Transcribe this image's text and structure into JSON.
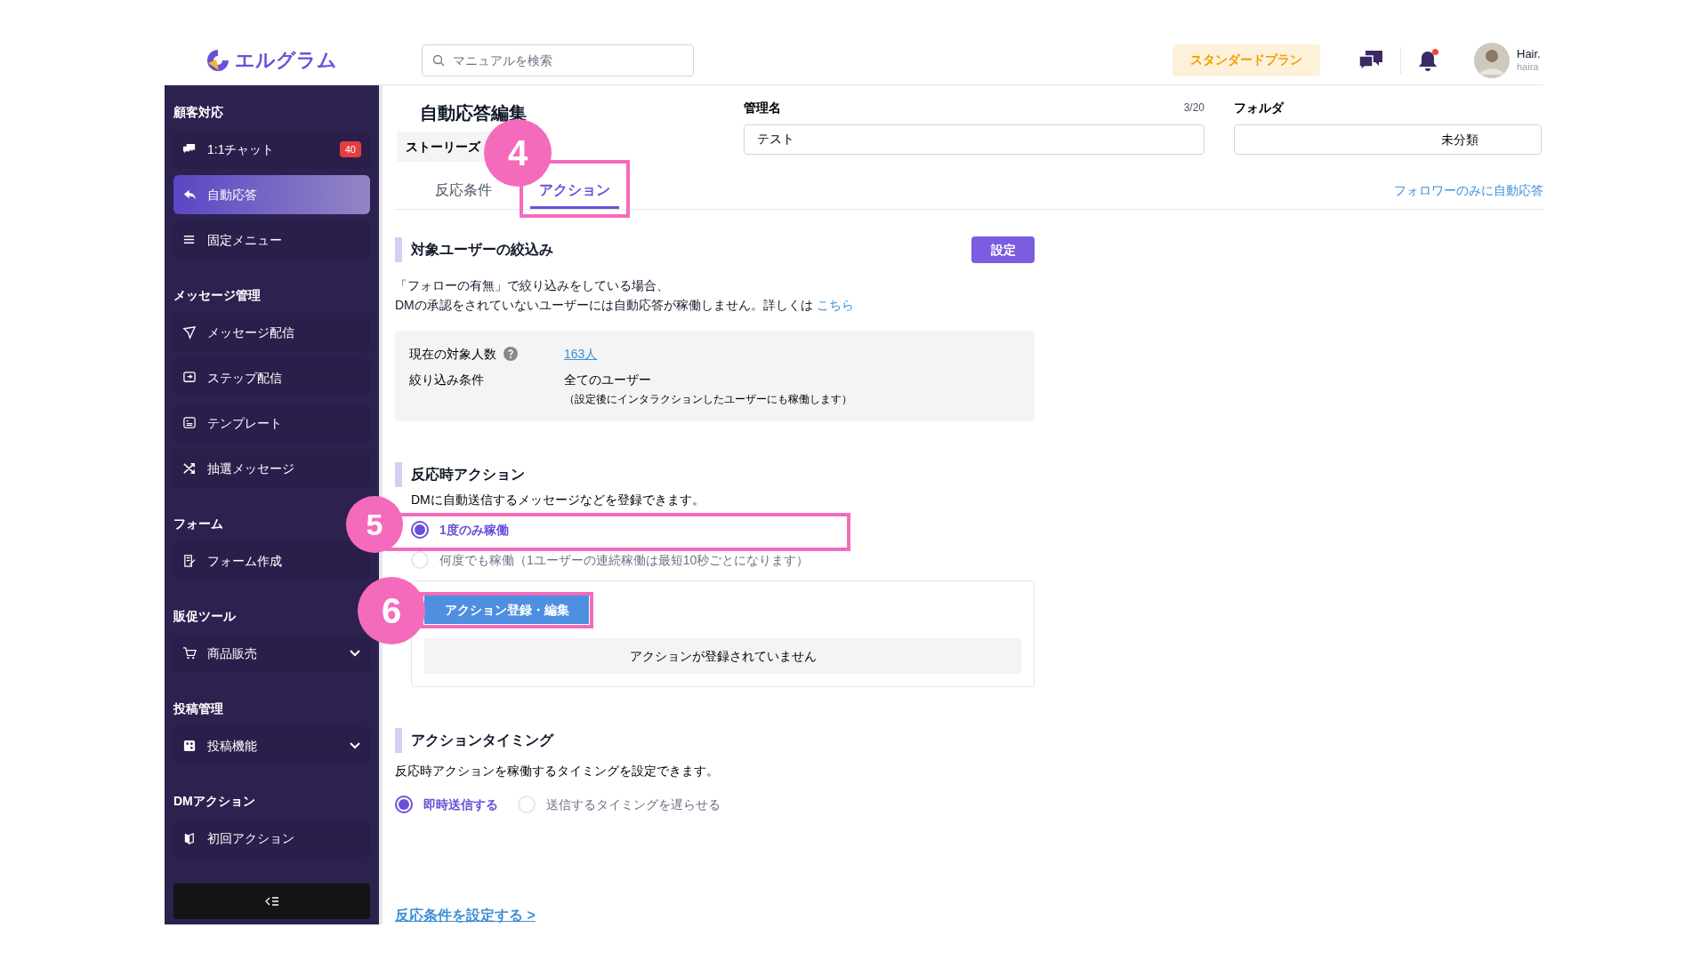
{
  "header": {
    "logo": "エルグラム",
    "search": {
      "placeholder": "マニュアルを検索"
    },
    "plan": "スタンダードプラン",
    "notification": true,
    "user": {
      "name": "Hair.",
      "id": "haira"
    }
  },
  "sidebar": {
    "sections": [
      {
        "title": "顧客対応",
        "items": [
          {
            "label": "1:1チャット",
            "badge": "40",
            "selected": false,
            "kind": "link"
          },
          {
            "label": "自動応答",
            "selected": true,
            "kind": "link"
          },
          {
            "label": "固定メニュー",
            "selected": false,
            "kind": "link"
          }
        ]
      },
      {
        "title": "メッセージ管理",
        "items": [
          {
            "label": "メッセージ配信",
            "selected": false,
            "kind": "link"
          },
          {
            "label": "ステップ配信",
            "selected": false,
            "kind": "link"
          },
          {
            "label": "テンプレート",
            "selected": false,
            "kind": "link"
          },
          {
            "label": "抽選メッセージ",
            "selected": false,
            "kind": "link"
          }
        ]
      },
      {
        "title": "フォーム",
        "items": [
          {
            "label": "フォーム作成",
            "selected": false,
            "kind": "link"
          }
        ]
      },
      {
        "title": "販促ツール",
        "items": [
          {
            "label": "商品販売",
            "selected": false,
            "kind": "dropdown"
          }
        ]
      },
      {
        "title": "投稿管理",
        "items": [
          {
            "label": "投稿機能",
            "selected": false,
            "kind": "dropdown"
          }
        ]
      },
      {
        "title": "DMアクション",
        "items": [
          {
            "label": "初回アクション",
            "selected": false,
            "kind": "link"
          }
        ]
      }
    ]
  },
  "editor": {
    "title": "自動応答編集",
    "chip": "ストーリーズ",
    "name_field": {
      "label": "管理名",
      "counter": "3/20",
      "value": "テスト"
    },
    "folder_field": {
      "label": "フォルダ",
      "value": "未分類"
    },
    "tabs": [
      {
        "label": "反応条件",
        "selected": false
      },
      {
        "label": "アクション",
        "selected": true
      }
    ],
    "follower_link": "フォロワーのみに自動応答"
  },
  "filter": {
    "title": "対象ユーザーの絞込み",
    "button": "設定",
    "note": "「フォローの有無」で絞り込みをしている場合、\nDMの承認をされていないユーザーには自動応答が稼働しません。詳しくは",
    "note_link": "こちら",
    "stats": [
      {
        "label": "現在の対象人数",
        "value": "163人",
        "kind": "link"
      },
      {
        "label": "絞り込み条件",
        "value": "全てのユーザー",
        "sub": "（設定後にインタラクションしたユーザーにも稼働します）",
        "kind": "text"
      }
    ]
  },
  "reaction": {
    "title": "反応時アクション",
    "description": "DMに自動送信するメッセージなどを登録できます。",
    "options": [
      {
        "label": "1度のみ稼働",
        "selected": true
      },
      {
        "label": "何度でも稼働（1ユーザーの連続稼働は最短10秒ごとになります）",
        "selected": false
      }
    ],
    "button": "アクション登録・編集",
    "empty": "アクションが登録されていません"
  },
  "timing": {
    "title": "アクションタイミング",
    "description": "反応時アクションを稼働するタイミングを設定できます。",
    "options": [
      {
        "label": "即時送信する",
        "selected": true
      },
      {
        "label": "送信するタイミングを遅らせる",
        "selected": false
      }
    ]
  },
  "bottom_link": "反応条件を設定する >",
  "callouts": [
    {
      "number": "4"
    },
    {
      "number": "5"
    },
    {
      "number": "6"
    }
  ]
}
